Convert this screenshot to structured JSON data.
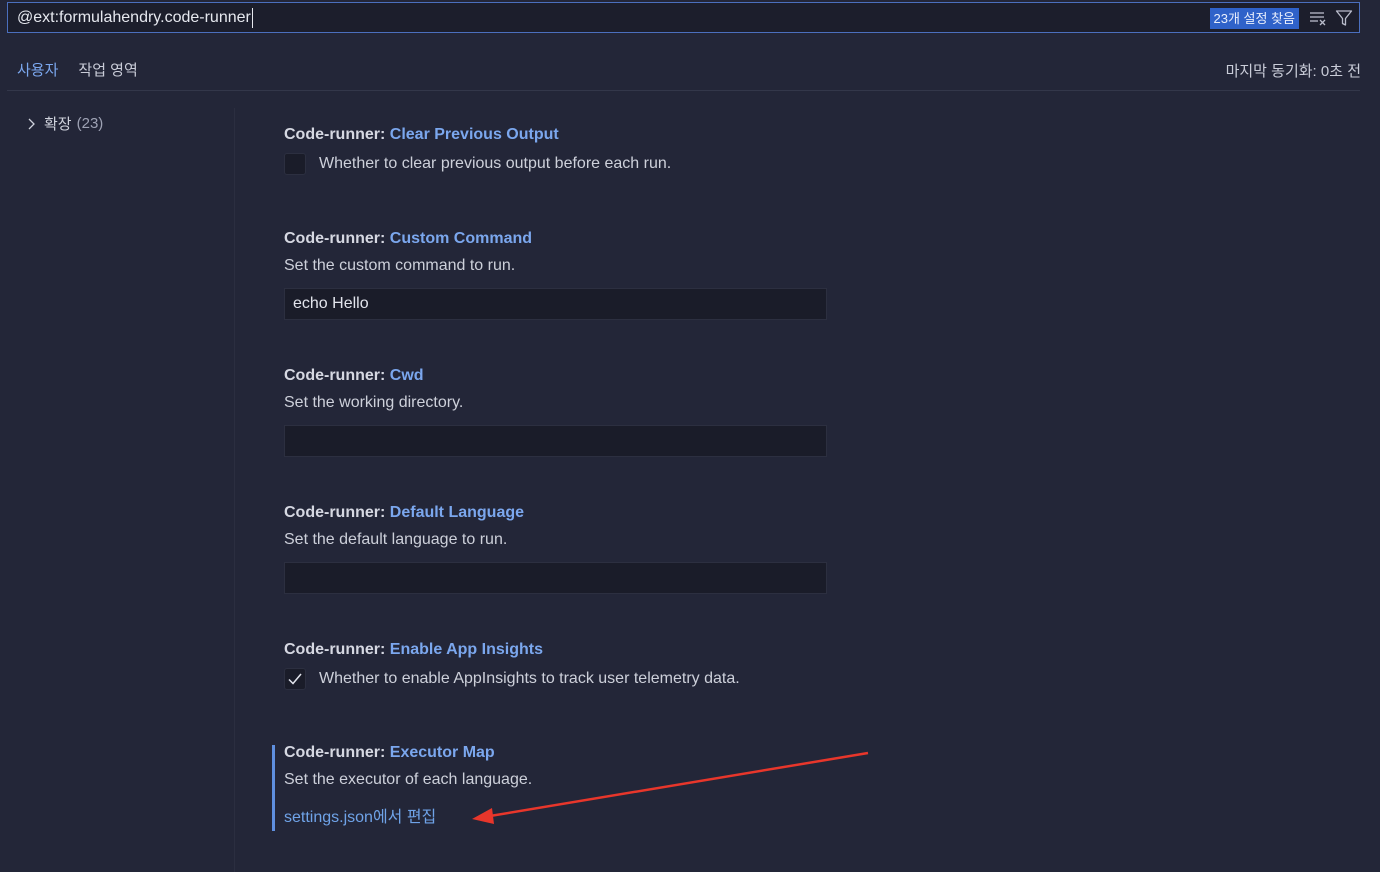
{
  "search": {
    "query": "@ext:formulahendry.code-runner",
    "results_badge": "23개 설정 찾음"
  },
  "tabs": [
    {
      "label": "사용자",
      "active": true
    },
    {
      "label": "작업 영역",
      "active": false
    }
  ],
  "sync_status": "마지막 동기화: 0초 전",
  "toc": {
    "label": "확장",
    "count": "(23)"
  },
  "settings": [
    {
      "prefix": "Code-runner: ",
      "key": "Clear Previous Output",
      "type": "checkbox",
      "checked": false,
      "description": "Whether to clear previous output before each run."
    },
    {
      "prefix": "Code-runner: ",
      "key": "Custom Command",
      "type": "text",
      "description": "Set the custom command to run.",
      "value": "echo Hello"
    },
    {
      "prefix": "Code-runner: ",
      "key": "Cwd",
      "type": "text",
      "description": "Set the working directory.",
      "value": ""
    },
    {
      "prefix": "Code-runner: ",
      "key": "Default Language",
      "type": "text",
      "description": "Set the default language to run.",
      "value": ""
    },
    {
      "prefix": "Code-runner: ",
      "key": "Enable App Insights",
      "type": "checkbox",
      "checked": true,
      "description": "Whether to enable AppInsights to track user telemetry data."
    },
    {
      "prefix": "Code-runner: ",
      "key": "Executor Map",
      "type": "link",
      "description": "Set the executor of each language.",
      "link_label": "settings.json에서 편집"
    }
  ],
  "colors": {
    "accent": "#7ba7ee",
    "badge": "#2f62c9",
    "annotation_arrow": "#e8362b",
    "background": "#232638"
  },
  "icons": {
    "clear": "clear-filter-icon",
    "filter": "filter-icon",
    "chevron": "chevron-right-icon",
    "check": "check-icon"
  }
}
